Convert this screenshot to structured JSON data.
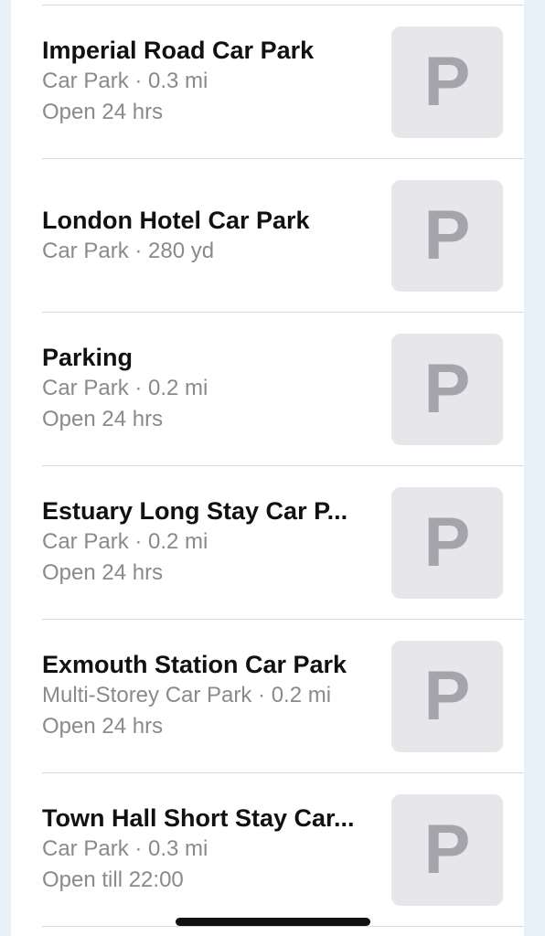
{
  "results": [
    {
      "name": "Imperial Road Car Park",
      "detail": "Car Park · 0.3 mi",
      "hours": "Open 24 hrs",
      "thumb_letter": "P"
    },
    {
      "name": "London Hotel Car Park",
      "detail": "Car Park · 280 yd",
      "hours": "",
      "thumb_letter": "P"
    },
    {
      "name": "Parking",
      "detail": "Car Park · 0.2 mi",
      "hours": "Open 24 hrs",
      "thumb_letter": "P"
    },
    {
      "name": "Estuary Long Stay Car P...",
      "detail": "Car Park · 0.2 mi",
      "hours": "Open 24 hrs",
      "thumb_letter": "P"
    },
    {
      "name": "Exmouth Station Car Park",
      "detail": "Multi-Storey Car Park · 0.2 mi",
      "hours": "Open 24 hrs",
      "thumb_letter": "P"
    },
    {
      "name": "Town Hall Short Stay Car...",
      "detail": "Car Park · 0.3 mi",
      "hours": "Open till 22:00",
      "thumb_letter": "P"
    }
  ]
}
